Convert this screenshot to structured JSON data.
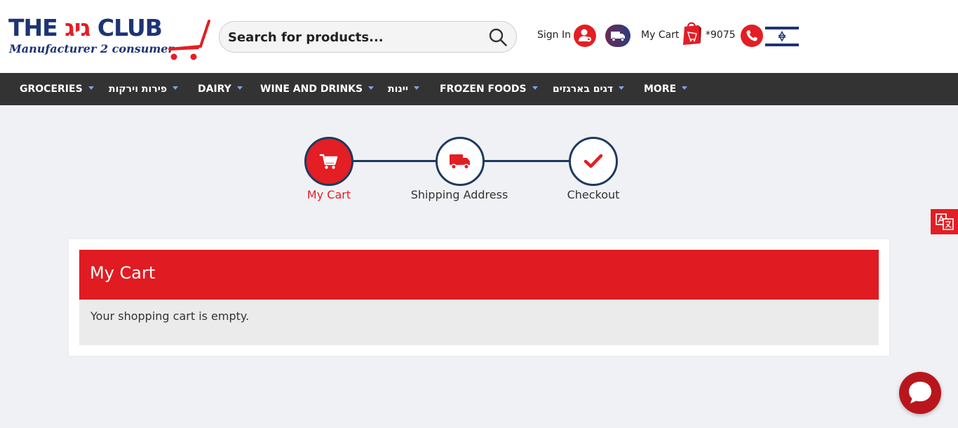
{
  "header": {
    "logo": {
      "text_left": "THE ",
      "text_red": "גיג",
      "text_right": " CLUB",
      "tagline": "Manufacturer 2 consumer"
    },
    "search": {
      "placeholder": "Search for products..."
    },
    "sign_in_label": "Sign In",
    "cart_label": "My Cart",
    "phone_number": "*9075"
  },
  "nav": {
    "items": [
      {
        "label": "GROCERIES"
      },
      {
        "label": "פירות וירקות"
      },
      {
        "label": "DAIRY"
      },
      {
        "label": "WINE AND DRINKS"
      },
      {
        "label": "יינות"
      },
      {
        "label": "FROZEN FOODS"
      },
      {
        "label": "דגים בארגזים"
      },
      {
        "label": "MORE"
      }
    ]
  },
  "steps": [
    {
      "label": "My Cart",
      "icon": "cart-icon",
      "active": true
    },
    {
      "label": "Shipping Address",
      "icon": "truck-icon",
      "active": false
    },
    {
      "label": "Checkout",
      "icon": "check-icon",
      "active": false
    }
  ],
  "cart": {
    "title": "My Cart",
    "empty_message": "Your shopping cart is empty."
  },
  "colors": {
    "brand_red": "#e31e24",
    "brand_navy": "#1d3474",
    "nav_bg": "#333333",
    "page_bg": "#f0f1f5"
  }
}
